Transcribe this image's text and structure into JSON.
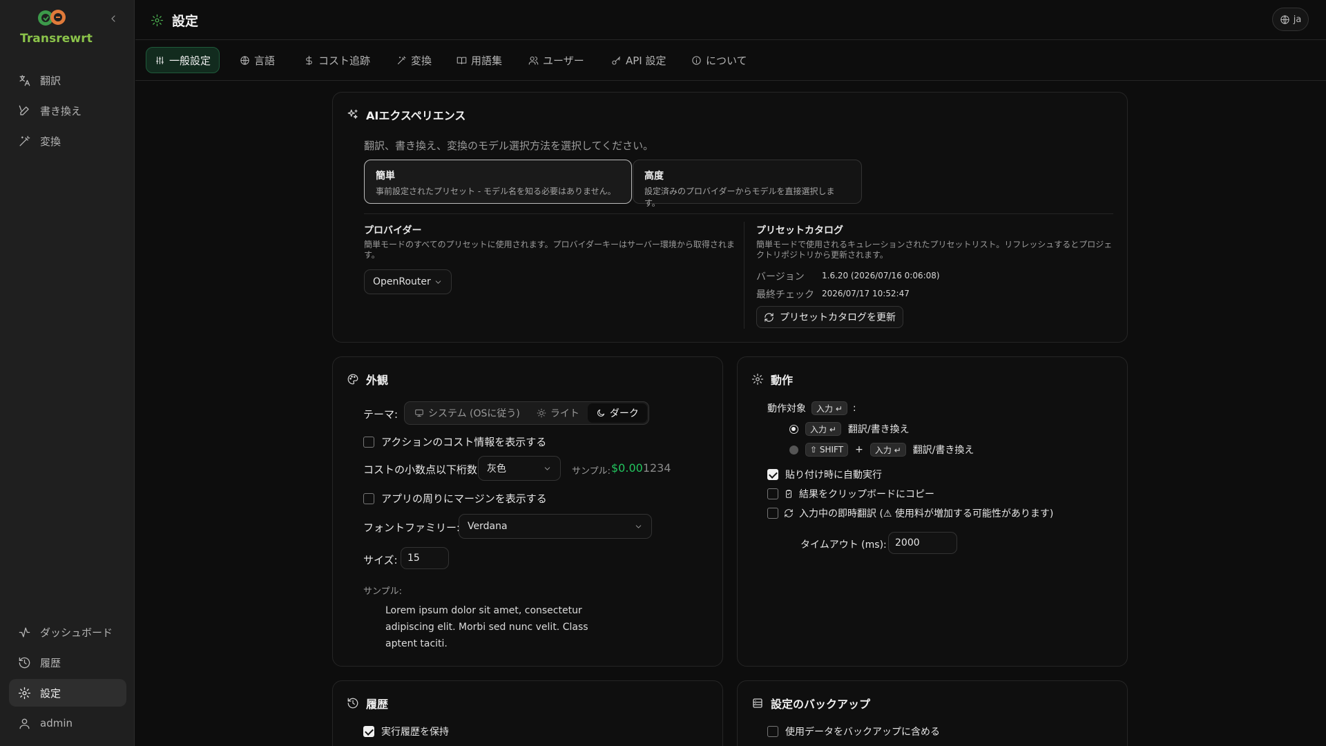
{
  "app": {
    "name": "Transrewrt",
    "page_title": "設定",
    "lang": "ja"
  },
  "sidebar": {
    "top_items": [
      {
        "label": "翻訳",
        "icon": "translate-icon"
      },
      {
        "label": "書き換え",
        "icon": "pen-icon"
      },
      {
        "label": "変換",
        "icon": "wand-icon"
      }
    ],
    "bottom_items": [
      {
        "label": "ダッシュボード",
        "icon": "activity-icon"
      },
      {
        "label": "履歴",
        "icon": "history-icon"
      },
      {
        "label": "設定",
        "icon": "gear-icon",
        "active": true
      },
      {
        "label": "admin",
        "icon": "user-icon"
      }
    ]
  },
  "tabs": [
    {
      "label": "一般設定",
      "icon": "sliders-icon",
      "active": true
    },
    {
      "label": "言語",
      "icon": "globe-icon"
    },
    {
      "label": "コスト追跡",
      "icon": "dollar-icon"
    },
    {
      "label": "変換",
      "icon": "wand-icon"
    },
    {
      "label": "用語集",
      "icon": "book-icon"
    },
    {
      "label": "ユーザー",
      "icon": "users-icon"
    },
    {
      "label": "API 設定",
      "icon": "key-icon"
    },
    {
      "label": "について",
      "icon": "info-icon"
    }
  ],
  "ai": {
    "title": "AIエクスペリエンス",
    "description": "翻訳、書き換え、変換のモデル選択方法を選択してください。",
    "modes": [
      {
        "title": "簡単",
        "desc": "事前設定されたプリセット - モデル名を知る必要はありません。",
        "selected": true
      },
      {
        "title": "高度",
        "desc": "設定済みのプロバイダーからモデルを直接選択します。",
        "selected": false
      }
    ],
    "provider": {
      "label": "プロバイダー",
      "desc": "簡単モードのすべてのプリセットに使用されます。プロバイダーキーはサーバー環境から取得されます。",
      "value": "OpenRouter"
    },
    "catalog": {
      "label": "プリセットカタログ",
      "desc": "簡単モードで使用されるキュレーションされたプリセットリスト。リフレッシュするとプロジェクトリポジトリから更新されます。",
      "version_label": "バージョン",
      "version_value": "1.6.20 (2026/07/16 0:06:08)",
      "checked_label": "最終チェック",
      "checked_value": "2026/07/17 10:52:47",
      "refresh_label": "プリセットカタログを更新"
    }
  },
  "appearance": {
    "title": "外観",
    "theme_label": "テーマ:",
    "theme_options": [
      "システム (OSに従う)",
      "ライト",
      "ダーク"
    ],
    "theme_selected": "ダーク",
    "show_cost_label": "アクションのコスト情報を表示する",
    "show_cost": false,
    "decimals_label": "コストの小数点以下桁数:",
    "decimals_value": "灰色",
    "sample_label": "サンプル:",
    "sample_price_main": "$0.00",
    "sample_price_rest": "1234",
    "margin_label": "アプリの周りにマージンを表示する",
    "margin": false,
    "font_family_label": "フォントファミリー:",
    "font_family_value": "Verdana",
    "size_label": "サイズ:",
    "size_value": "15",
    "preview_label": "サンプル:",
    "preview_text": "Lorem ipsum dolor sit amet, consectetur adipiscing elit. Morbi sed nunc velit. Class aptent taciti."
  },
  "behavior": {
    "title": "動作",
    "target_label": "動作対象",
    "target_key": "入力 ↵",
    "colon": ":",
    "options": [
      {
        "keys": [
          "入力 ↵"
        ],
        "plus": "",
        "action": "翻訳/書き換え",
        "selected": true
      },
      {
        "keys": [
          "⇧ SHIFT",
          "入力 ↵"
        ],
        "plus": "+",
        "action": "翻訳/書き換え",
        "selected": false
      }
    ],
    "auto_paste_label": "貼り付け時に自動実行",
    "auto_paste": true,
    "copy_label": "結果をクリップボードにコピー",
    "copy": false,
    "instant_label": "入力中の即時翻訳 (⚠ 使用料が増加する可能性があります)",
    "instant": false,
    "timeout_label": "タイムアウト (ms):",
    "timeout_value": "2000"
  },
  "history": {
    "title": "履歴",
    "keep_label": "実行履歴を保持",
    "keep": true
  },
  "backup": {
    "title": "設定のバックアップ",
    "include_label": "使用データをバックアップに含める",
    "include": false
  },
  "colors": {
    "accent": "#4caf50",
    "brand_green": "#8bc34a",
    "price_green": "#22c55e"
  }
}
